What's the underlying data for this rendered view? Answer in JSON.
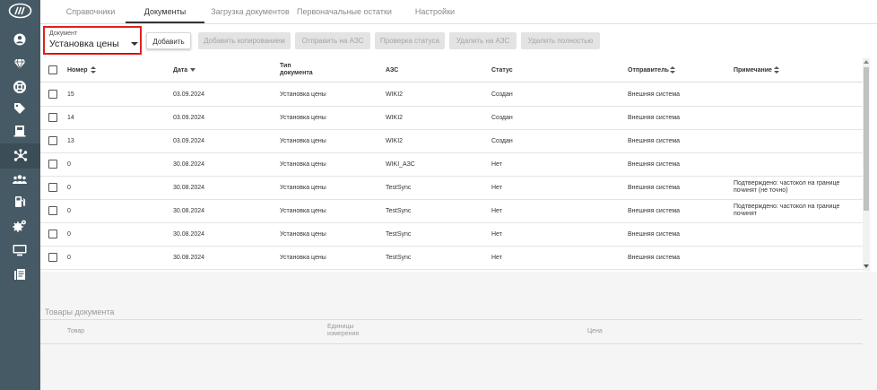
{
  "sidebar": {
    "items": [
      {
        "icon": "user-icon"
      },
      {
        "icon": "diamond-icon"
      },
      {
        "icon": "lifebuoy-icon"
      },
      {
        "icon": "tag-icon"
      },
      {
        "icon": "fuel-dispenser-icon"
      },
      {
        "icon": "network-icon",
        "active": true
      },
      {
        "icon": "users-icon"
      },
      {
        "icon": "fuel-pump-icon"
      },
      {
        "icon": "settings-gears-icon"
      },
      {
        "icon": "monitor-icon"
      },
      {
        "icon": "documents-icon"
      }
    ],
    "bg_color": "#455a64"
  },
  "tabs": [
    {
      "label": "Справочники"
    },
    {
      "label": "Документы",
      "active": true
    },
    {
      "label": "Загрузка документов"
    },
    {
      "label": "Первоначальные остатки"
    },
    {
      "label": "Настройки"
    }
  ],
  "toolbar": {
    "doc_select_label": "Документ",
    "doc_select_value": "Установка цены",
    "buttons": {
      "add": "Добавить",
      "add_copy": "Добавить копированием",
      "send_azs": "Отправить на АЗС",
      "check_status": "Проверка статуса",
      "delete_azs": "Удалить на АЗС",
      "delete_full": "Удалить полностью"
    }
  },
  "table": {
    "headers": {
      "number": "Номер",
      "date": "Дата",
      "type_line1": "Тип",
      "type_line2": "документа",
      "azs": "АЗС",
      "status": "Статус",
      "sender": "Отправитель",
      "note": "Примечание"
    },
    "rows": [
      {
        "number": "15",
        "date": "03.09.2024",
        "type": "Установка цены",
        "azs": "WIKI2",
        "status": "Создан",
        "sender": "Внешняя система",
        "note": ""
      },
      {
        "number": "14",
        "date": "03.09.2024",
        "type": "Установка цены",
        "azs": "WIKI2",
        "status": "Создан",
        "sender": "Внешняя система",
        "note": ""
      },
      {
        "number": "13",
        "date": "03.09.2024",
        "type": "Установка цены",
        "azs": "WIKI2",
        "status": "Создан",
        "sender": "Внешняя система",
        "note": ""
      },
      {
        "number": "0",
        "date": "30.08.2024",
        "type": "Установка цены",
        "azs": "WIKI_АЗС",
        "status": "Нет",
        "sender": "Внешняя система",
        "note": ""
      },
      {
        "number": "0",
        "date": "30.08.2024",
        "type": "Установка цены",
        "azs": "TestSync",
        "status": "Нет",
        "sender": "Внешняя система",
        "note": "Подтверждено: частокол на границе починят (не точно)"
      },
      {
        "number": "0",
        "date": "30.08.2024",
        "type": "Установка цены",
        "azs": "TestSync",
        "status": "Нет",
        "sender": "Внешняя система",
        "note": "Подтверждено: частокол на границе починят"
      },
      {
        "number": "0",
        "date": "30.08.2024",
        "type": "Установка цены",
        "azs": "TestSync",
        "status": "Нет",
        "sender": "Внешняя система",
        "note": ""
      },
      {
        "number": "0",
        "date": "30.08.2024",
        "type": "Установка цены",
        "azs": "TestSync",
        "status": "Нет",
        "sender": "Внешняя система",
        "note": ""
      }
    ]
  },
  "goods": {
    "title": "Товары документа",
    "headers": {
      "product": "Товар",
      "units_line1": "Единицы",
      "units_line2": "измерения",
      "price": "Цена"
    }
  },
  "colors": {
    "highlight_border": "#e02020",
    "disabled_button_bg": "#e3e3e3"
  }
}
